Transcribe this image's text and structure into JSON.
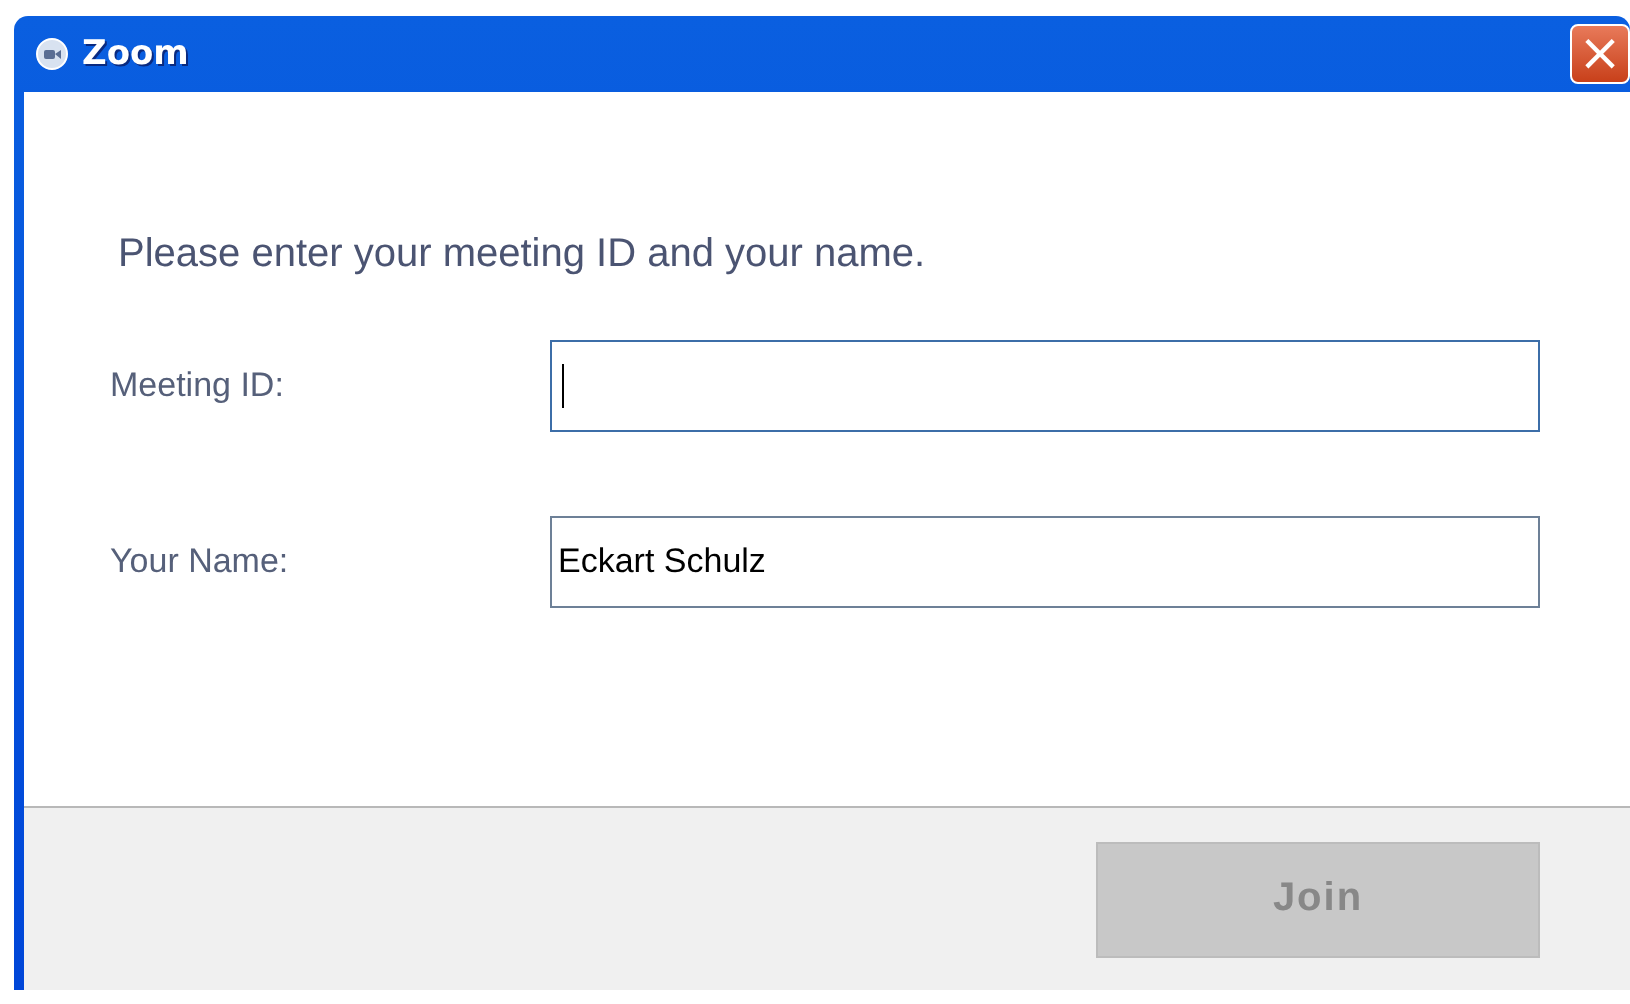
{
  "window": {
    "title": "Zoom",
    "close": "×"
  },
  "prompt": "Please enter your meeting ID and your name.",
  "fields": [
    {
      "label": "Meeting ID:",
      "focused": true
    },
    {
      "label": "Your Name:",
      "value": "Eckart Schulz",
      "focused": false
    }
  ],
  "buttons": [
    {
      "label": "Join",
      "disabled": true
    }
  ]
}
